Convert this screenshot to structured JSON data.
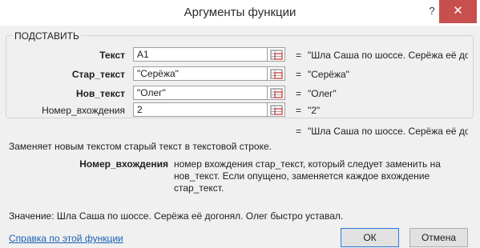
{
  "dialog": {
    "title": "Аргументы функции",
    "help_glyph": "?",
    "close_glyph": "✕"
  },
  "function_group": {
    "name": "ПОДСТАВИТЬ",
    "args": [
      {
        "label": "Текст",
        "value": "A1",
        "result": "\"Шла Саша по шоссе. Серёжа её дог"
      },
      {
        "label": "Стар_текст",
        "value": "\"Серёжа\"",
        "result": "\"Серёжа\""
      },
      {
        "label": "Нов_текст",
        "value": "\"Олег\"",
        "result": "\"Олег\""
      },
      {
        "label": "Номер_вхождения",
        "value": "2",
        "result": "\"2\""
      }
    ],
    "eq": "="
  },
  "overall_result": "\"Шла Саша по шоссе. Серёжа её дог",
  "description": "Заменяет новым текстом старый текст в текстовой строке.",
  "arg_help": {
    "name": "Номер_вхождения",
    "text": "номер вхождения стар_текст, который следует заменить на нов_текст. Если опущено, заменяется каждое вхождение стар_текст."
  },
  "value_line": "Значение:   Шла Саша по шоссе. Серёжа её догонял. Олег быстро уставал.",
  "help_link": "Справка по этой функции",
  "buttons": {
    "ok": "ОК",
    "cancel": "Отмена"
  },
  "colors": {
    "close": "#c7504f",
    "link": "#1a5fb4",
    "ok_border": "#2a7ad6"
  }
}
